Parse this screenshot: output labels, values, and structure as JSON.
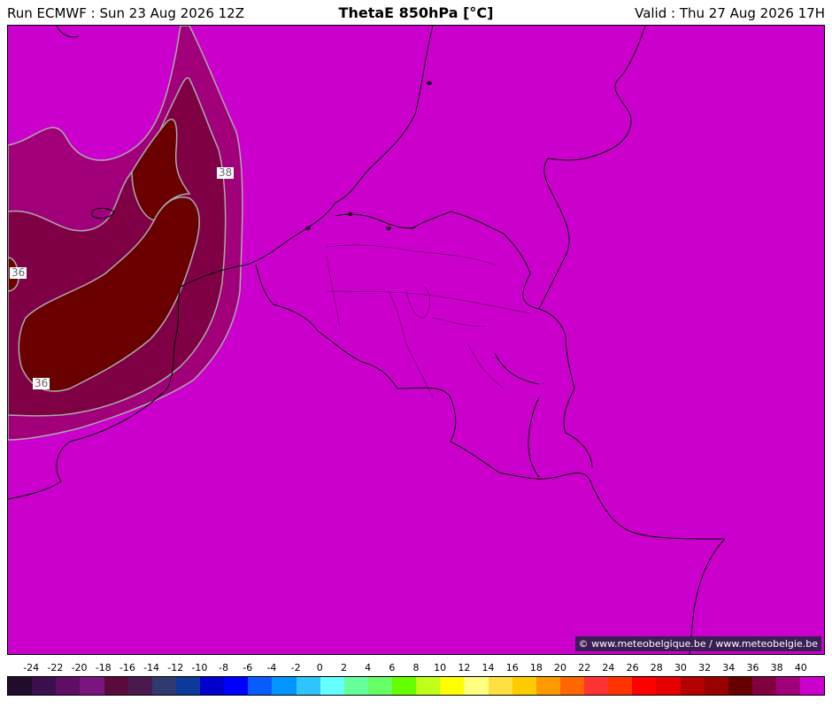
{
  "header": {
    "run_label": "Run ECMWF : Sun 23 Aug 2026 12Z",
    "title": "ThetaE 850hPa [°C]",
    "valid_label": "Valid : Thu 27 Aug 2026 17H"
  },
  "map": {
    "background_color": "#cc00cc",
    "contour_labels": [
      "38",
      "36",
      "36"
    ],
    "copyright": "© www.meteobelgique.be / www.meteobelgie.be"
  },
  "legend": {
    "ticks": [
      "-24",
      "-22",
      "-20",
      "-18",
      "-16",
      "-14",
      "-12",
      "-10",
      "-8",
      "-6",
      "-4",
      "-2",
      "0",
      "2",
      "4",
      "6",
      "8",
      "10",
      "12",
      "14",
      "16",
      "18",
      "20",
      "22",
      "24",
      "26",
      "28",
      "30",
      "32",
      "34",
      "36",
      "38",
      "40"
    ],
    "colors": [
      "#220c2c",
      "#3b0e4d",
      "#5e0e63",
      "#7a1580",
      "#5a0a3c",
      "#4a1a4f",
      "#2f3a6e",
      "#0b3a9a",
      "#0000cc",
      "#0000ff",
      "#0a5bff",
      "#0095ff",
      "#2ec4ff",
      "#66ffff",
      "#66ff99",
      "#66ff66",
      "#66ff00",
      "#bfff1a",
      "#ffff00",
      "#ffff80",
      "#ffe040",
      "#ffcc00",
      "#ff9900",
      "#ff6600",
      "#ff3333",
      "#ff3300",
      "#ff0000",
      "#e60000",
      "#b30000",
      "#990000",
      "#660000",
      "#800040",
      "#a0007a",
      "#cc00cc"
    ]
  }
}
